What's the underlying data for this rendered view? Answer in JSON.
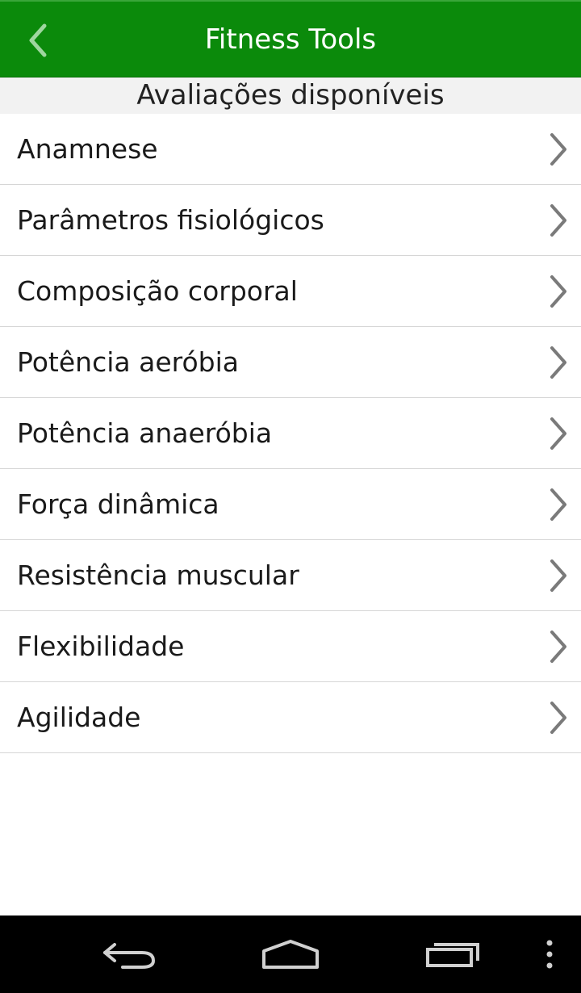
{
  "app": {
    "title": "Fitness Tools",
    "accent_color": "#0b8a0b"
  },
  "header": {
    "back_icon": "chevron-left-icon",
    "section_title": "Avaliações disponíveis"
  },
  "list": {
    "items": [
      {
        "label": "Anamnese",
        "icon": "chevron-right-icon"
      },
      {
        "label": "Parâmetros fisiológicos",
        "icon": "chevron-right-icon"
      },
      {
        "label": "Composição corporal",
        "icon": "chevron-right-icon"
      },
      {
        "label": "Potência aeróbia",
        "icon": "chevron-right-icon"
      },
      {
        "label": "Potência anaeróbia",
        "icon": "chevron-right-icon"
      },
      {
        "label": "Força dinâmica",
        "icon": "chevron-right-icon"
      },
      {
        "label": "Resistência muscular",
        "icon": "chevron-right-icon"
      },
      {
        "label": "Flexibilidade",
        "icon": "chevron-right-icon"
      },
      {
        "label": "Agilidade",
        "icon": "chevron-right-icon"
      }
    ]
  },
  "system_nav": {
    "buttons": [
      "back-arrow-icon",
      "home-icon",
      "recent-apps-icon",
      "overflow-menu-icon"
    ]
  }
}
